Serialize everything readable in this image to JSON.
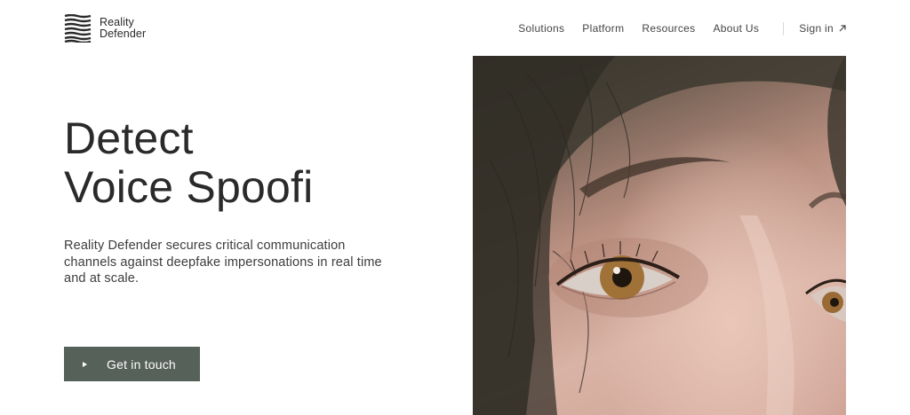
{
  "brand": {
    "line1": "Reality",
    "line2": "Defender"
  },
  "nav": {
    "items": [
      "Solutions",
      "Platform",
      "Resources",
      "About Us"
    ],
    "signin_label": "Sign in"
  },
  "hero": {
    "title_line1": "Detect",
    "title_line2": "Voice Spoofi",
    "description": "Reality Defender secures critical communication channels against deepfake impersonations in real time and at scale.",
    "cta_label": "Get in touch"
  },
  "colors": {
    "cta_bg": "#56615a",
    "text": "#2a2a2a"
  },
  "icons": {
    "logo": "wave-lines-logo-icon",
    "signin": "arrow-up-right-icon",
    "cta": "play-triangle-icon"
  }
}
